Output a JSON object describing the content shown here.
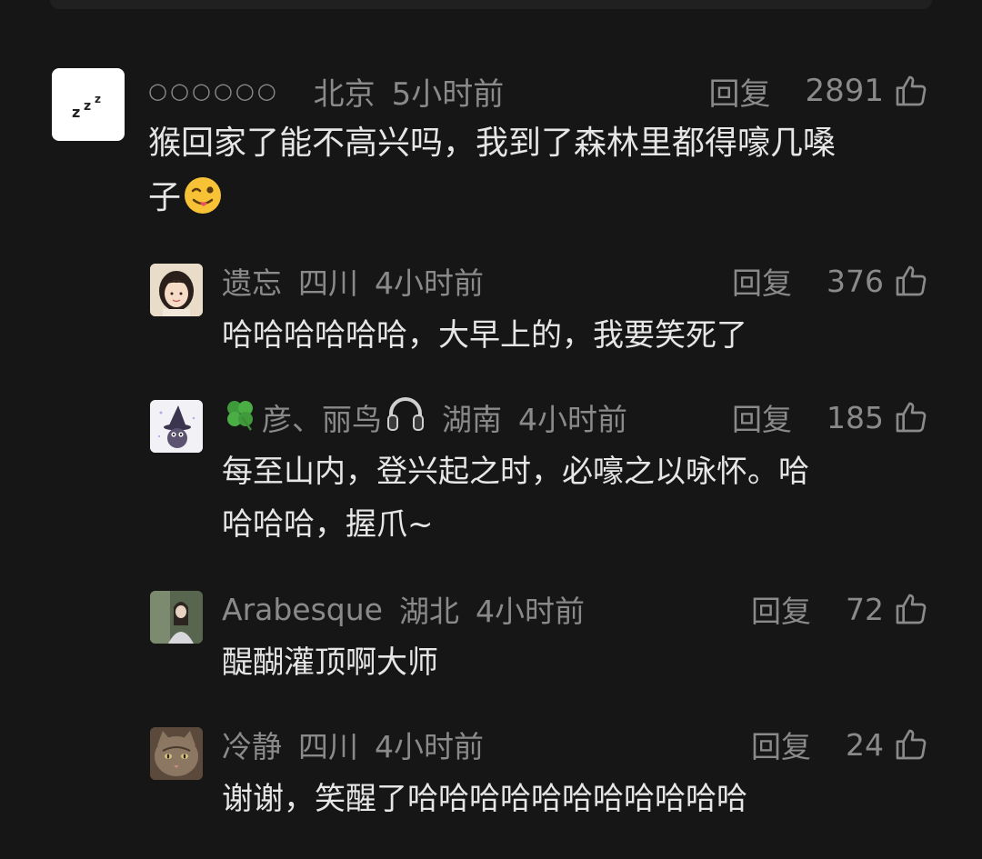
{
  "comments": [
    {
      "username": "○○○○○○",
      "location": "北京",
      "time": "5小时前",
      "reply_label": "回复",
      "likes": "2891",
      "text_line1": "猴回家了能不高兴吗，我到了森林里都得嚎几嗓",
      "text_line2": "子",
      "emoji": "winking-tongue-emoji",
      "avatar_text": "zzz"
    },
    {
      "username": "遗忘",
      "location": "四川",
      "time": "4小时前",
      "reply_label": "回复",
      "likes": "376",
      "text_line1": "哈哈哈哈哈哈，大早上的，我要笑死了"
    },
    {
      "username": "彦、丽鸟",
      "username_prefix_icon": "four-leaf-clover-icon",
      "username_suffix_icon": "headphones-icon",
      "location": "湖南",
      "time": "4小时前",
      "reply_label": "回复",
      "likes": "185",
      "text_line1": "每至山内，登兴起之时，必嚎之以咏怀。哈",
      "text_line2": "哈哈哈，握爪~"
    },
    {
      "username": "Arabesque",
      "location": "湖北",
      "time": "4小时前",
      "reply_label": "回复",
      "likes": "72",
      "text_line1": "醍醐灌顶啊大师"
    },
    {
      "username": "冷静",
      "location": "四川",
      "time": "4小时前",
      "reply_label": "回复",
      "likes": "24",
      "text_line1": "谢谢，笑醒了哈哈哈哈哈哈哈哈哈哈哈"
    }
  ],
  "colors": {
    "background": "#161616",
    "meta_text": "#8a8a8a",
    "body_text": "#e6e6e6"
  }
}
